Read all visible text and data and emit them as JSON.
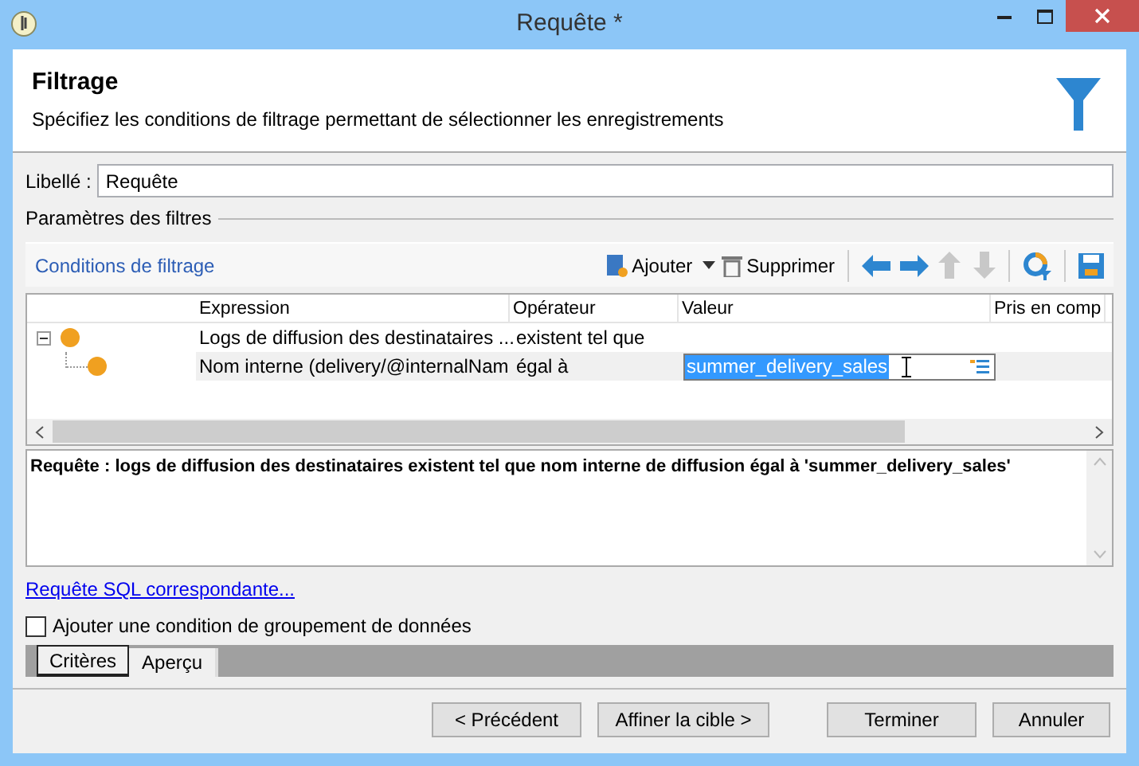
{
  "window": {
    "title": "Requête *"
  },
  "header": {
    "title": "Filtrage",
    "subtitle": "Spécifiez les conditions de filtrage permettant de sélectionner les enregistrements"
  },
  "label_field": {
    "label": "Libellé :",
    "value": "Requête"
  },
  "section_title": "Paramètres des filtres",
  "toolbar": {
    "title": "Conditions de filtrage",
    "add": "Ajouter",
    "delete": "Supprimer"
  },
  "table": {
    "columns": [
      "Expression",
      "Opérateur",
      "Valeur",
      "Pris en comp"
    ],
    "rows": [
      {
        "expression": "Logs de diffusion des destinataires ...",
        "operator": "existent tel que",
        "expanded": true,
        "selected": false,
        "children": [
          {
            "expression": "Nom interne (delivery/@internalNam",
            "operator": "égal à",
            "value": "summer_delivery_sales",
            "selected": true
          }
        ]
      }
    ]
  },
  "summary": "**Requête :** **logs de diffusion des destinataires existent tel que nom interne de diffusion égal à 'summer_delivery_sales'**",
  "sql_link": "Requête SQL correspondante...",
  "grouping_checkbox": {
    "label": "Ajouter une condition de groupement de données",
    "checked": false
  },
  "tabs": [
    {
      "label": "Critères",
      "selected": true
    },
    {
      "label": "Aperçu",
      "selected": false
    }
  ],
  "buttons": [
    "< Précédent",
    "Affiner la cible >",
    "Terminer",
    "Annuler"
  ]
}
